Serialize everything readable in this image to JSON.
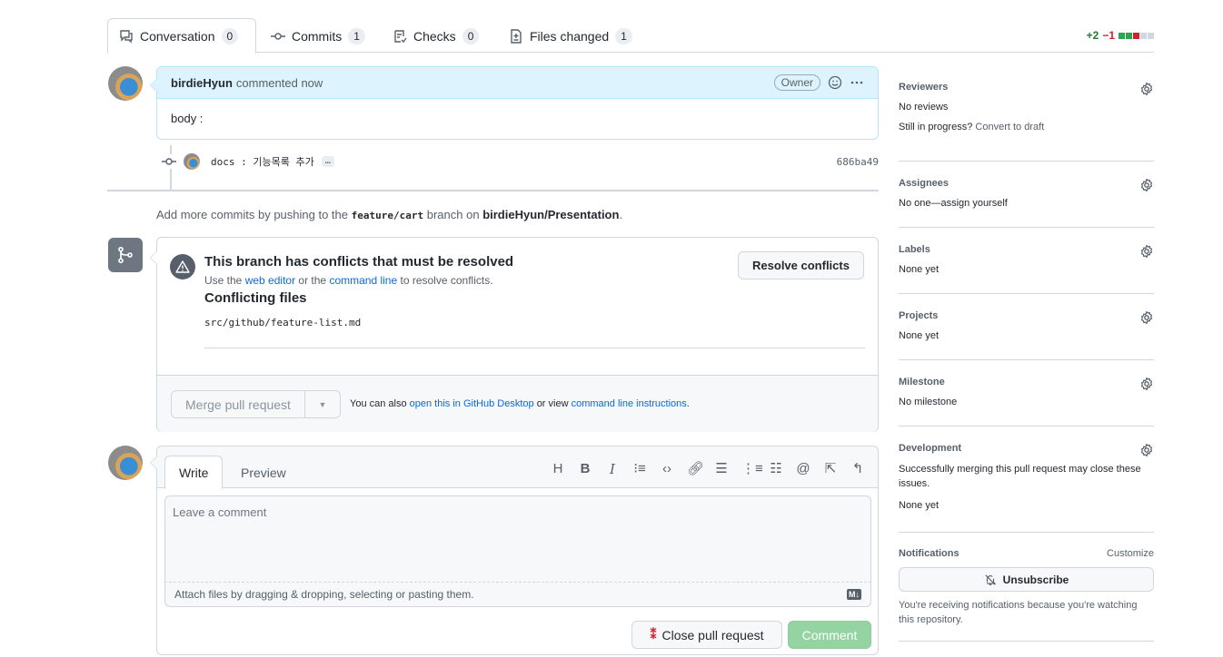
{
  "tabs": [
    {
      "label": "Conversation",
      "count": "0"
    },
    {
      "label": "Commits",
      "count": "1"
    },
    {
      "label": "Checks",
      "count": "0"
    },
    {
      "label": "Files changed",
      "count": "1"
    }
  ],
  "diffstat": {
    "additions": "+2",
    "deletions": "−1",
    "colors": [
      "#2da44e",
      "#2da44e",
      "#cf222e",
      "#d0d7de",
      "#d0d7de"
    ]
  },
  "comment": {
    "author": "birdieHyun",
    "action": "commented now",
    "badge": "Owner",
    "body": "body :"
  },
  "commit": {
    "message": "docs : 기능목록 추가",
    "ellipsis": "…",
    "sha": "686ba49"
  },
  "push_note": {
    "prefix": "Add more commits by pushing to the",
    "branch": "feature/cart",
    "middle": "branch on",
    "repo": "birdieHyun/Presentation",
    "suffix": "."
  },
  "conflicts": {
    "title": "This branch has conflicts that must be resolved",
    "sub_prefix": "Use the",
    "web_editor": "web editor",
    "sub_or": "or the",
    "command_line": "command line",
    "sub_suffix": "to resolve conflicts.",
    "files_title": "Conflicting files",
    "file": "src/github/feature-list.md",
    "resolve_button": "Resolve conflicts"
  },
  "merge": {
    "button": "Merge pull request",
    "hint_prefix": "You can also",
    "desktop_link": "open this in GitHub Desktop",
    "hint_middle": "or view",
    "cli_link": "command line instructions",
    "hint_suffix": "."
  },
  "new_comment": {
    "write_tab": "Write",
    "preview_tab": "Preview",
    "placeholder": "Leave a comment",
    "attach": "Attach files by dragging & dropping, selecting or pasting them.",
    "markdown_badge": "M↓",
    "close_button": "Close pull request",
    "comment_button": "Comment",
    "toolbar": [
      "H",
      "B",
      "I",
      "quote",
      "code",
      "link",
      "ul",
      "ol",
      "tasklist",
      "@",
      "reference",
      "undo"
    ]
  },
  "sidebar": {
    "reviewers": {
      "title": "Reviewers",
      "line1": "No reviews",
      "line2_prefix": "Still in progress?",
      "line2_link": "Convert to draft"
    },
    "assignees": {
      "title": "Assignees",
      "text": "No one—assign yourself"
    },
    "labels": {
      "title": "Labels",
      "text": "None yet"
    },
    "projects": {
      "title": "Projects",
      "text": "None yet"
    },
    "milestone": {
      "title": "Milestone",
      "text": "No milestone"
    },
    "development": {
      "title": "Development",
      "text": "Successfully merging this pull request may close these issues.",
      "text2": "None yet"
    },
    "notifications": {
      "title": "Notifications",
      "customize": "Customize",
      "button": "Unsubscribe",
      "note": "You're receiving notifications because you're watching this repository."
    }
  }
}
